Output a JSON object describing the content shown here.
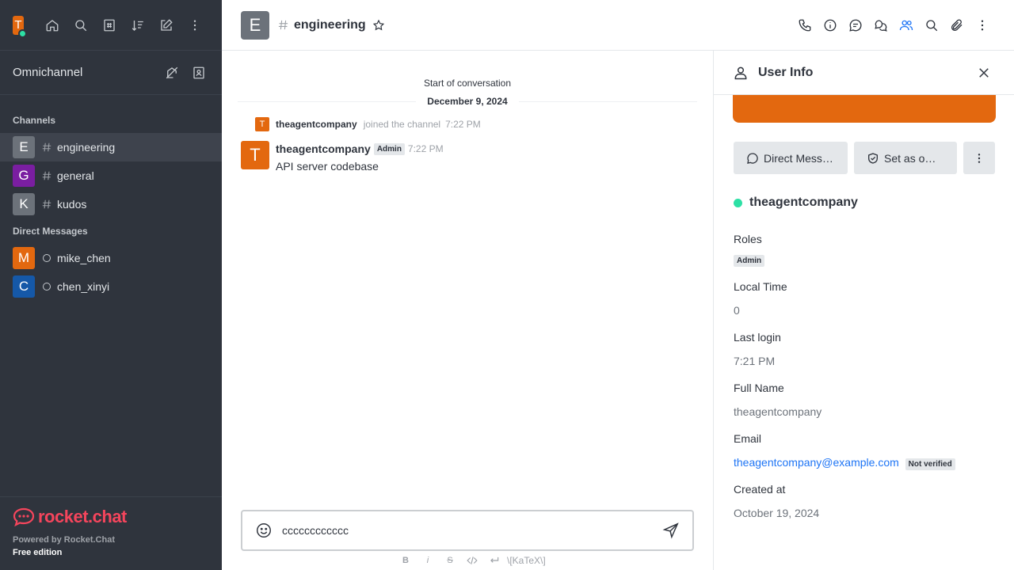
{
  "sidebar": {
    "user_initial": "T",
    "omnichannel_label": "Omnichannel",
    "channels_header": "Channels",
    "channels": [
      {
        "initial": "E",
        "name": "engineering",
        "color": "#6c727a"
      },
      {
        "initial": "G",
        "name": "general",
        "color": "#7a1ea1"
      },
      {
        "initial": "K",
        "name": "kudos",
        "color": "#6c727a"
      }
    ],
    "dm_header": "Direct Messages",
    "dms": [
      {
        "initial": "M",
        "name": "mike_chen",
        "color": "#e3680f"
      },
      {
        "initial": "C",
        "name": "chen_xinyi",
        "color": "#1558a8"
      }
    ],
    "logo_text": "rocket.chat",
    "powered_by": "Powered by Rocket.Chat",
    "edition": "Free edition"
  },
  "header": {
    "room_initial": "E",
    "room_name": "engineering"
  },
  "messages": {
    "start_text": "Start of conversation",
    "date_divider": "December 9, 2024",
    "system": {
      "initial": "T",
      "user": "theagentcompany",
      "text": "joined the channel",
      "time": "7:22 PM"
    },
    "message": {
      "initial": "T",
      "user": "theagentcompany",
      "badge": "Admin",
      "time": "7:22 PM",
      "text": "API server codebase"
    }
  },
  "composer": {
    "value": "cccccccccccc",
    "katex_label": "\\[KaTeX\\]"
  },
  "panel": {
    "title": "User Info",
    "dm_button": "Direct Mess…",
    "owner_button": "Set as o…",
    "username": "theagentcompany",
    "roles_label": "Roles",
    "role": "Admin",
    "local_time_label": "Local Time",
    "local_time_value": "0",
    "last_login_label": "Last login",
    "last_login_value": "7:21 PM",
    "full_name_label": "Full Name",
    "full_name_value": "theagentcompany",
    "email_label": "Email",
    "email_value": "theagentcompany@example.com",
    "email_status": "Not verified",
    "created_label": "Created at",
    "created_value": "October 19, 2024"
  },
  "colors": {
    "accent": "#1d74f5",
    "brand_orange": "#e3680f",
    "online": "#2de0a5",
    "logo_red": "#f5455c"
  }
}
